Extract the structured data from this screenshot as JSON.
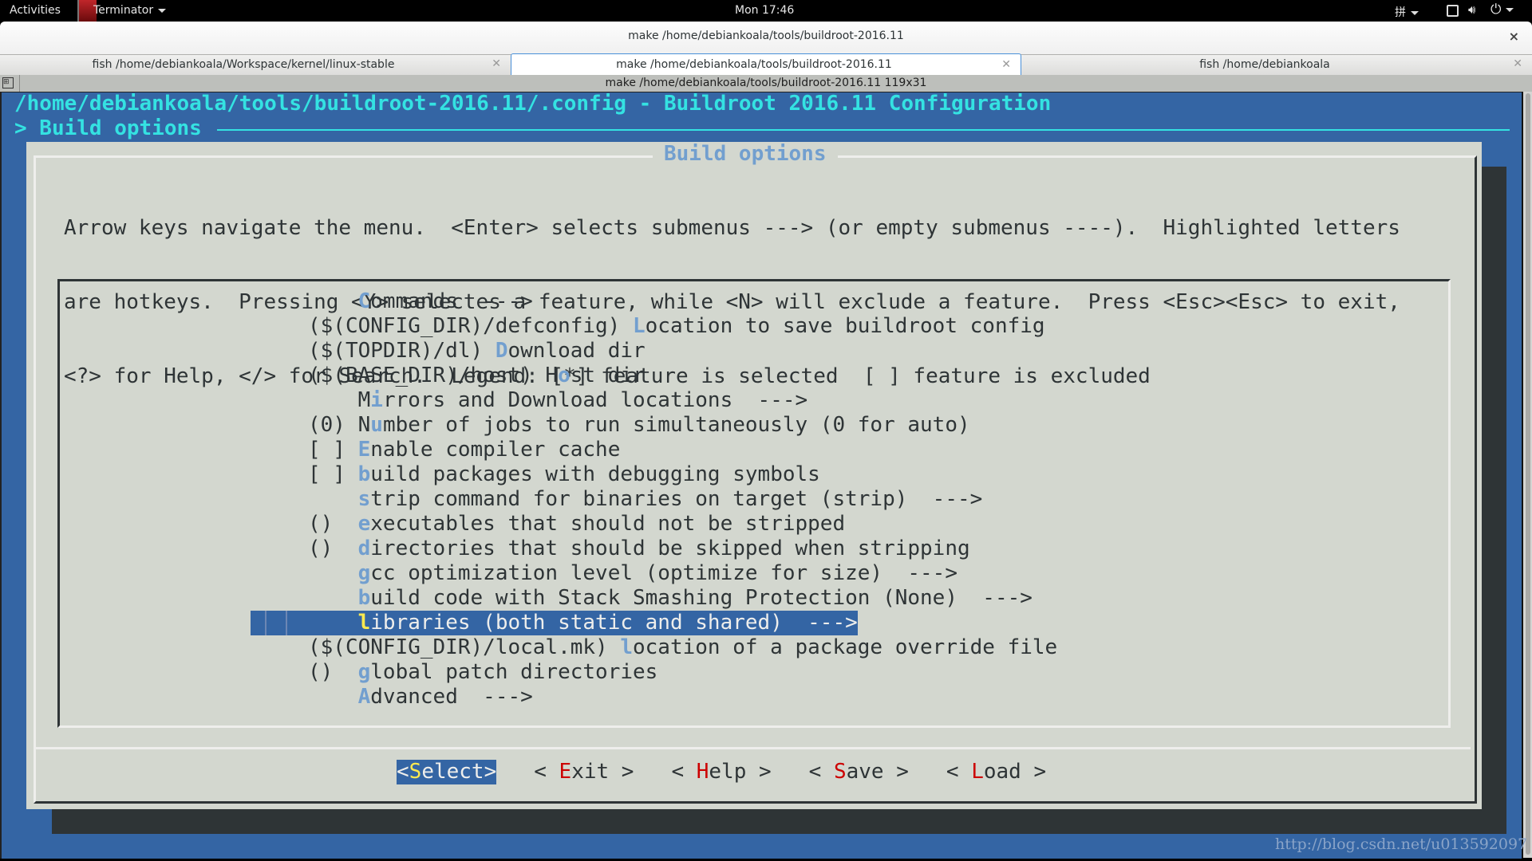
{
  "topbar": {
    "activities": "Activities",
    "app_name": "Terminator",
    "clock": "Mon 17:46",
    "input_method": "拼",
    "tray_icons": [
      "window-icon",
      "volume-icon",
      "power-icon"
    ]
  },
  "window": {
    "title": "make  /home/debiankoala/tools/buildroot-2016.11",
    "close_glyph": "×"
  },
  "tabs": [
    {
      "label": "fish  /home/debiankoala/Workspace/kernel/linux-stable",
      "active": false
    },
    {
      "label": "make  /home/debiankoala/tools/buildroot-2016.11",
      "active": true
    },
    {
      "label": "fish  /home/debiankoala",
      "active": false
    }
  ],
  "tab_close_glyph": "✕",
  "terminal": {
    "title": "make  /home/debiankoala/tools/buildroot-2016.11 119x31",
    "header_path": "/home/debiankoala/tools/buildroot-2016.11/.config - Buildroot 2016.11 Configuration",
    "breadcrumb": "> Build options"
  },
  "dialog": {
    "title": "Build options",
    "help_lines": [
      "Arrow keys navigate the menu.  <Enter> selects submenus ---> (or empty submenus ----).  Highlighted letters",
      "are hotkeys.  Pressing <Y> selectes a feature, while <N> will exclude a feature.  Press <Esc><Esc> to exit,",
      "<?> for Help, </> for Search.  Legend: [*] feature is selected  [ ] feature is excluded"
    ],
    "menu_items": [
      {
        "prefix": "    ",
        "pre": "",
        "hotkey": "C",
        "post": "ommands  --->"
      },
      {
        "prefix": "($(CONFIG_DIR)/defconfig) ",
        "pre": "",
        "hotkey": "L",
        "post": "ocation to save buildroot config"
      },
      {
        "prefix": "($(TOPDIR)/dl) ",
        "pre": "",
        "hotkey": "D",
        "post": "ownload dir"
      },
      {
        "prefix": "($(BASE_DIR)/host) ",
        "pre": "H",
        "hotkey": "o",
        "post": "st dir"
      },
      {
        "prefix": "    ",
        "pre": "M",
        "hotkey": "i",
        "post": "rrors and Download locations  --->"
      },
      {
        "prefix": "(0) ",
        "pre": "N",
        "hotkey": "u",
        "post": "mber of jobs to run simultaneously (0 for auto)"
      },
      {
        "prefix": "[ ] ",
        "pre": "",
        "hotkey": "E",
        "post": "nable compiler cache"
      },
      {
        "prefix": "[ ] ",
        "pre": "",
        "hotkey": "b",
        "post": "uild packages with debugging symbols"
      },
      {
        "prefix": "    ",
        "pre": "",
        "hotkey": "s",
        "post": "trip command for binaries on target (strip)  --->"
      },
      {
        "prefix": "()  ",
        "pre": "",
        "hotkey": "e",
        "post": "xecutables that should not be stripped"
      },
      {
        "prefix": "()  ",
        "pre": "",
        "hotkey": "d",
        "post": "irectories that should be skipped when stripping"
      },
      {
        "prefix": "    ",
        "pre": "",
        "hotkey": "g",
        "post": "cc optimization level (optimize for size)  --->"
      },
      {
        "prefix": "    ",
        "pre": "",
        "hotkey": "b",
        "post": "uild code with Stack Smashing Protection (None)  --->"
      },
      {
        "prefix": "    ",
        "pre": "",
        "hotkey": "l",
        "post": "ibraries (both static and shared)  --->",
        "selected": true
      },
      {
        "prefix": "($(CONFIG_DIR)/local.mk) ",
        "pre": "",
        "hotkey": "l",
        "post": "ocation of a package override file"
      },
      {
        "prefix": "()  ",
        "pre": "",
        "hotkey": "g",
        "post": "lobal patch directories"
      },
      {
        "prefix": "    ",
        "pre": "",
        "hotkey": "A",
        "post": "dvanced  --->"
      }
    ],
    "buttons": [
      {
        "open": "<",
        "hotkey": "S",
        "rest": "elect",
        "close": ">",
        "selected": true
      },
      {
        "open": "< ",
        "hotkey": "E",
        "rest": "xit",
        "close": " >"
      },
      {
        "open": "< ",
        "hotkey": "H",
        "rest": "elp",
        "close": " >"
      },
      {
        "open": "< ",
        "hotkey": "S",
        "rest": "ave",
        "close": " >"
      },
      {
        "open": "< ",
        "hotkey": "L",
        "rest": "oad",
        "close": " >"
      }
    ]
  },
  "colors": {
    "terminal_bg": "#3465a4",
    "header_text": "#34e2e2",
    "dialog_bg": "#d3d7cf",
    "hotkey": "#729fcf",
    "button_hotkey": "#cc0000",
    "selected_hotkey": "#fce94f"
  },
  "watermark": "http://blog.csdn.net/u013592097"
}
